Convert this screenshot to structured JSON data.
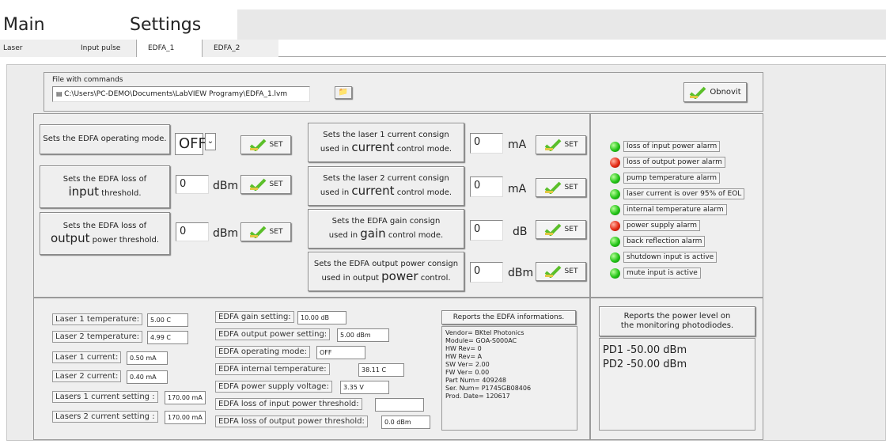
{
  "main_tabs": [
    "Main",
    "Settings"
  ],
  "sub_tabs": [
    "Laser",
    "Input pulse",
    "EDFA_1",
    "EDFA_2"
  ],
  "file": {
    "label": "File with commands",
    "path": "C:\\Users\\PC-DEMO\\Documents\\LabVIEW Programy\\EDFA_1.lvm"
  },
  "obnovit_label": "Obnovit",
  "set_label": "SET",
  "commands": {
    "op_mode": {
      "label": "Sets the EDFA operating mode.",
      "value": "OFF"
    },
    "input_threshold": {
      "line1": "Sets the EDFA loss of",
      "big": "input",
      "rest": " threshold.",
      "value": "0",
      "unit": "dBm"
    },
    "output_threshold": {
      "line1": "Sets the EDFA loss of",
      "big": "output",
      "rest": " power threshold.",
      "value": "0",
      "unit": "dBm"
    },
    "laser1_current": {
      "line1": "Sets the laser 1 current consign",
      "pre": "used in ",
      "big": "current",
      "rest": " control mode.",
      "value": "0",
      "unit": "mA"
    },
    "laser2_current": {
      "line1": "Sets the laser 2 current consign",
      "pre": "used in ",
      "big": "current",
      "rest": " control mode.",
      "value": "0",
      "unit": "mA"
    },
    "gain": {
      "line1": "Sets the EDFA gain consign",
      "pre": "used in ",
      "big": "gain",
      "rest": " control mode.",
      "value": "0",
      "unit": "dB"
    },
    "output_power": {
      "line1": "Sets the EDFA output power consign",
      "pre": "used in output ",
      "big": "power",
      "rest": " control.",
      "value": "0",
      "unit": "dBm"
    }
  },
  "alarms": [
    {
      "label": "loss of input power alarm",
      "color": "green"
    },
    {
      "label": "loss of output power alarm",
      "color": "red"
    },
    {
      "label": "pump temperature alarm",
      "color": "green"
    },
    {
      "label": "laser current is over 95% of EOL",
      "color": "green"
    },
    {
      "label": "internal temperature alarm",
      "color": "green"
    },
    {
      "label": "power supply alarm",
      "color": "red"
    },
    {
      "label": "back reflection alarm",
      "color": "green"
    },
    {
      "label": "shutdown input is active",
      "color": "green"
    },
    {
      "label": "mute input is active",
      "color": "green"
    }
  ],
  "status_left": [
    {
      "label": "Laser 1 temperature:",
      "value": "5.00 C"
    },
    {
      "label": "Laser 2 temperature:",
      "value": "4.99 C"
    },
    {
      "label": "Laser 1 current:",
      "value": "0.50 mA"
    },
    {
      "label": "Laser 2 current:",
      "value": "0.40 mA"
    },
    {
      "label": "Lasers 1 current setting :",
      "value": "170.00 mA"
    },
    {
      "label": "Lasers 2 current setting :",
      "value": "170.00 mA"
    }
  ],
  "status_mid": [
    {
      "label": "EDFA gain setting:",
      "value": "10.00 dB"
    },
    {
      "label": "EDFA output power setting:",
      "value": "5.00 dBm"
    },
    {
      "label": "EDFA operating mode:",
      "value": "OFF"
    },
    {
      "label": "EDFA internal temperature:",
      "value": "38.11 C"
    },
    {
      "label": "EDFA power supply voltage:",
      "value": "3.35 V"
    },
    {
      "label": "EDFA loss of input power threshold:",
      "value": ""
    },
    {
      "label": "EDFA loss of output power threshold:",
      "value": "0.0 dBm"
    }
  ],
  "info": {
    "button": "Reports the EDFA informations.",
    "lines": [
      "Vendor= BKtel Photonics",
      "Module= GOA-S000AC",
      "HW Rev= 0",
      "HW Rev= A",
      "SW Ver= 2.00",
      "FW Ver= 0.00",
      "Part Num= 409248",
      "Ser. Num= P1745GB08406",
      "Prod. Date= 120617"
    ]
  },
  "power": {
    "button_line1": "Reports the power level on",
    "button_line2": "the monitoring photodiodes.",
    "pd1": "PD1 -50.00 dBm",
    "pd2": "PD2 -50.00 dBm"
  }
}
